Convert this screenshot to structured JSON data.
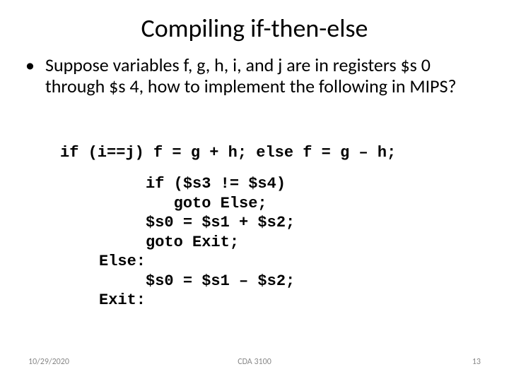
{
  "title": "Compiling if-then-else",
  "bullet_text": "Suppose variables f, g, h, i, and j are in registers $s 0 through $s 4, how to implement the following in MIPS?",
  "code_line": "if (i==j) f = g + h; else f = g – h;",
  "code_block": "     if ($s3 != $s4)\n        goto Else;\n     $s0 = $s1 + $s2;\n     goto Exit;\nElse:\n     $s0 = $s1 – $s2;\nExit:",
  "footer": {
    "date": "10/29/2020",
    "course": "CDA 3100",
    "page": "13"
  }
}
